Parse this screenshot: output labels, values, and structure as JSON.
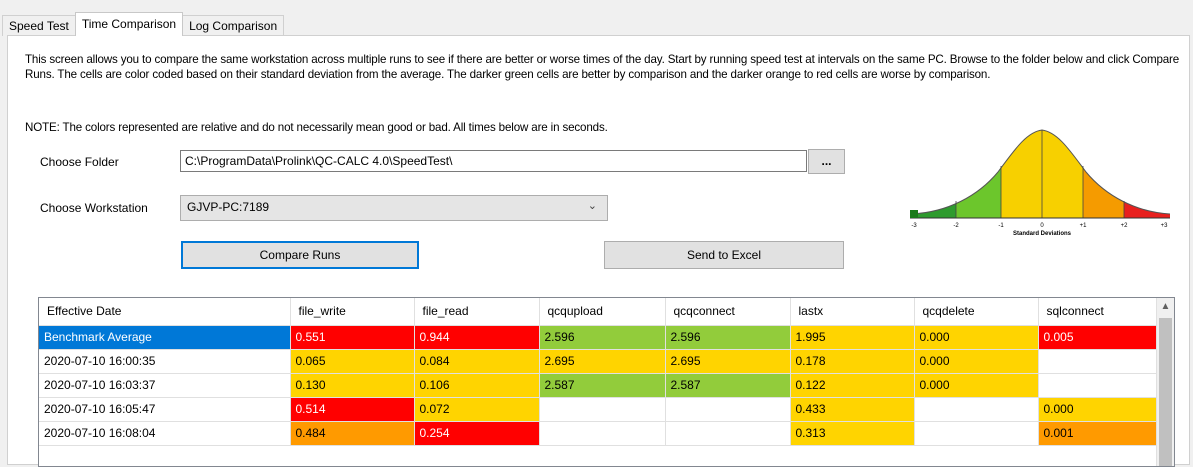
{
  "tabs": [
    {
      "label": "Speed Test",
      "active": false
    },
    {
      "label": "Time Comparison",
      "active": true
    },
    {
      "label": "Log Comparison",
      "active": false
    }
  ],
  "description": "This screen allows you to compare the same workstation across multiple runs to see if there are better or worse times of the day. Start by running speed test at intervals on the same PC. Browse to the folder below and click Compare Runs. The cells are color coded based on their standard deviation from the average. The darker green cells are better by comparison and the darker orange to red cells are worse by comparison.",
  "note": "NOTE: The colors represented are relative and do not necessarily mean good or bad. All times below are in seconds.",
  "folder": {
    "label": "Choose Folder",
    "value": "C:\\ProgramData\\Prolink\\QC-CALC 4.0\\SpeedTest\\",
    "browse_label": "..."
  },
  "workstation": {
    "label": "Choose Workstation",
    "value": "GJVP-PC:7189"
  },
  "buttons": {
    "compare": "Compare Runs",
    "excel": "Send to Excel"
  },
  "bell_curve": {
    "ticks": [
      "-3",
      "-2",
      "-1",
      "0",
      "+1",
      "+2",
      "+3"
    ],
    "axis_label": "Standard Deviations",
    "band_colors": [
      "#2e9b2e",
      "#6cc62c",
      "#9bcb3c",
      "#f7d000",
      "#f7d000",
      "#f59b00",
      "#e8201e"
    ]
  },
  "colors": {
    "red": "#ff0000",
    "orange": "#ff9a00",
    "yellow": "#ffd400",
    "green": "#92cc3b",
    "selection": "#0078d7"
  },
  "grid": {
    "columns": [
      "Effective Date",
      "file_write",
      "file_read",
      "qcqupload",
      "qcqconnect",
      "lastx",
      "qcqdelete",
      "sqlconnect"
    ],
    "rows": [
      {
        "selected": true,
        "cells": [
          {
            "v": "Benchmark Average",
            "c": ""
          },
          {
            "v": "0.551",
            "c": "red"
          },
          {
            "v": "0.944",
            "c": "red"
          },
          {
            "v": "2.596",
            "c": "green"
          },
          {
            "v": "2.596",
            "c": "green"
          },
          {
            "v": "1.995",
            "c": "yellow"
          },
          {
            "v": "0.000",
            "c": "yellow"
          },
          {
            "v": "0.005",
            "c": "red"
          }
        ]
      },
      {
        "selected": false,
        "cells": [
          {
            "v": "2020-07-10 16:00:35",
            "c": ""
          },
          {
            "v": "0.065",
            "c": "yellow"
          },
          {
            "v": "0.084",
            "c": "yellow"
          },
          {
            "v": "2.695",
            "c": "yellow"
          },
          {
            "v": "2.695",
            "c": "yellow"
          },
          {
            "v": "0.178",
            "c": "yellow"
          },
          {
            "v": "0.000",
            "c": "yellow"
          },
          {
            "v": "",
            "c": ""
          }
        ]
      },
      {
        "selected": false,
        "cells": [
          {
            "v": "2020-07-10 16:03:37",
            "c": ""
          },
          {
            "v": "0.130",
            "c": "yellow"
          },
          {
            "v": "0.106",
            "c": "yellow"
          },
          {
            "v": "2.587",
            "c": "green"
          },
          {
            "v": "2.587",
            "c": "green"
          },
          {
            "v": "0.122",
            "c": "yellow"
          },
          {
            "v": "0.000",
            "c": "yellow"
          },
          {
            "v": "",
            "c": ""
          }
        ]
      },
      {
        "selected": false,
        "cells": [
          {
            "v": "2020-07-10 16:05:47",
            "c": ""
          },
          {
            "v": "0.514",
            "c": "red"
          },
          {
            "v": "0.072",
            "c": "yellow"
          },
          {
            "v": "",
            "c": ""
          },
          {
            "v": "",
            "c": ""
          },
          {
            "v": "0.433",
            "c": "yellow"
          },
          {
            "v": "",
            "c": ""
          },
          {
            "v": "0.000",
            "c": "yellow"
          }
        ]
      },
      {
        "selected": false,
        "cells": [
          {
            "v": "2020-07-10 16:08:04",
            "c": ""
          },
          {
            "v": "0.484",
            "c": "orange"
          },
          {
            "v": "0.254",
            "c": "red"
          },
          {
            "v": "",
            "c": ""
          },
          {
            "v": "",
            "c": ""
          },
          {
            "v": "0.313",
            "c": "yellow"
          },
          {
            "v": "",
            "c": ""
          },
          {
            "v": "0.001",
            "c": "orange"
          }
        ]
      }
    ]
  }
}
